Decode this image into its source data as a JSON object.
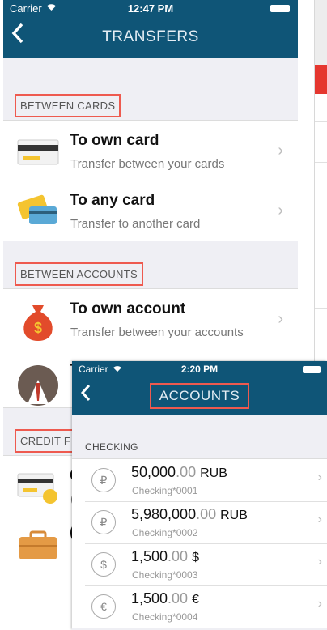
{
  "transfers": {
    "status": {
      "carrier": "Carrier",
      "time": "12:47 PM"
    },
    "title": "TRANSFERS",
    "sections": {
      "between_cards": "BETWEEN CARDS",
      "between_accounts": "BETWEEN ACCOUNTS",
      "credit": "CREDIT F"
    },
    "rows": [
      {
        "title": "To own card",
        "subtitle": "Transfer between your cards"
      },
      {
        "title": "To any card",
        "subtitle": "Transfer to another card"
      },
      {
        "title": "To own account",
        "subtitle": "Transfer between your accounts"
      },
      {
        "title": "T",
        "subtitle": ""
      },
      {
        "title": "C",
        "subtitle": "("
      },
      {
        "title": "(",
        "subtitle": ""
      }
    ]
  },
  "accounts": {
    "status": {
      "carrier": "Carrier",
      "time": "2:20 PM"
    },
    "title": "ACCOUNTS",
    "section": "CHECKING",
    "items": [
      {
        "currency_symbol": "₽",
        "amount_int": "50,000",
        "amount_dec": ".00",
        "currency": "RUB",
        "name": "Checking*0001"
      },
      {
        "currency_symbol": "₽",
        "amount_int": "5,980,000",
        "amount_dec": ".00",
        "currency": "RUB",
        "name": "Checking*0002"
      },
      {
        "currency_symbol": "$",
        "amount_int": "1,500",
        "amount_dec": ".00",
        "currency": "$",
        "name": "Checking*0003"
      },
      {
        "currency_symbol": "€",
        "amount_int": "1,500",
        "amount_dec": ".00",
        "currency": "€",
        "name": "Checking*0004"
      }
    ]
  },
  "colors": {
    "navbar": "#0f5577",
    "highlight": "#ee5a4f",
    "background": "#efeff4"
  },
  "icons": {
    "back": "chevron-left-icon",
    "chevron": "chevron-right-icon",
    "wifi": "wifi-icon",
    "battery": "battery-icon"
  }
}
